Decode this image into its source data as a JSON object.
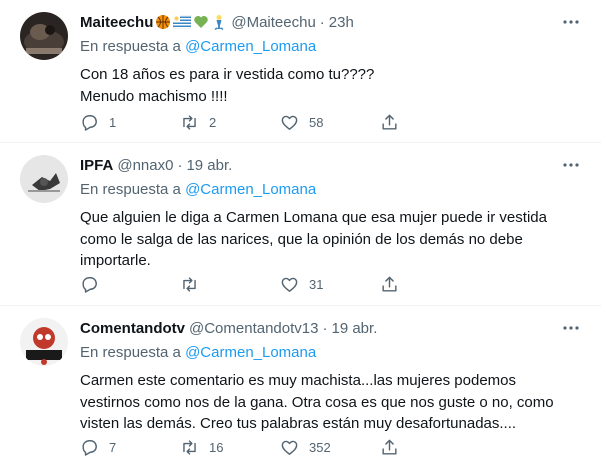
{
  "tweets": [
    {
      "name": "Maiteechu",
      "emojis": [
        "basketball",
        "uruguay-flag",
        "green-heart",
        "mermaid"
      ],
      "handle": "@Maiteechu",
      "dot": "·",
      "time": "23h",
      "reply_prefix": "En respuesta a",
      "reply_mention": "@Carmen_Lomana",
      "lines": [
        "Con 18 años es para ir vestida como tu????",
        "Menudo machismo !!!!"
      ],
      "replies": "1",
      "retweets": "2",
      "likes": "58"
    },
    {
      "name": "IPFA",
      "emojis": [],
      "handle": "@nnax0",
      "dot": "·",
      "time": "19 abr.",
      "reply_prefix": "En respuesta a",
      "reply_mention": "@Carmen_Lomana",
      "lines": [
        "Que alguien le diga a Carmen Lomana que esa mujer puede ir vestida",
        "como le salga de las narices, que la opinión de los demás no debe",
        "importarle."
      ],
      "replies": "",
      "retweets": "",
      "likes": "31"
    },
    {
      "name": "Comentandotv",
      "emojis": [],
      "handle": "@Comentandotv13",
      "dot": "·",
      "time": "19 abr.",
      "reply_prefix": "En respuesta a",
      "reply_mention": "@Carmen_Lomana",
      "lines": [
        "Carmen este comentario es muy machista...las mujeres podemos",
        "vestirnos como nos de la gana. Otra cosa es que nos guste o no, como",
        "visten las demás. Creo tus palabras están muy desafortunadas...."
      ],
      "replies": "7",
      "retweets": "16",
      "likes": "352"
    }
  ],
  "colors": {
    "text": "#0f1419",
    "secondary": "#536471",
    "link": "#1d9bf0",
    "divider": "#eff3f4"
  },
  "icons": [
    "reply-icon",
    "retweet-icon",
    "like-icon",
    "share-icon",
    "more-icon"
  ]
}
